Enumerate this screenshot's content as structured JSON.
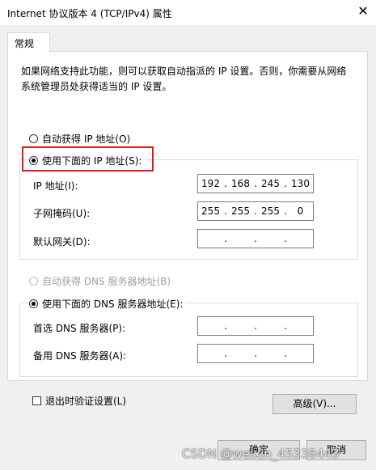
{
  "window": {
    "title": "Internet 协议版本 4 (TCP/IPv4) 属性",
    "close_glyph": "✕"
  },
  "tabs": [
    {
      "label": "常规"
    }
  ],
  "description": "如果网络支持此功能，则可以获取自动指派的 IP 设置。否则，你需要从网络系统管理员处获得适当的 IP 设置。",
  "ip": {
    "auto_label": "自动获得 IP 地址(O)",
    "manual_label": "使用下面的 IP 地址(S):",
    "selected": "manual",
    "fields": [
      {
        "label": "IP 地址(I):",
        "octets": [
          "192",
          "168",
          "245",
          "130"
        ]
      },
      {
        "label": "子网掩码(U):",
        "octets": [
          "255",
          "255",
          "255",
          "0"
        ]
      },
      {
        "label": "默认网关(D):",
        "octets": [
          "",
          "",
          "",
          ""
        ]
      }
    ]
  },
  "dns": {
    "auto_label": "自动获得 DNS 服务器地址(B)",
    "manual_label": "使用下面的 DNS 服务器地址(E):",
    "selected": "manual",
    "fields": [
      {
        "label": "首选 DNS 服务器(P):",
        "octets": [
          "",
          "",
          "",
          ""
        ]
      },
      {
        "label": "备用 DNS 服务器(A):",
        "octets": [
          "",
          "",
          "",
          ""
        ]
      }
    ]
  },
  "validate_checkbox": {
    "label": "退出时验证设置(L)",
    "checked": false
  },
  "buttons": {
    "advanced": "高级(V)...",
    "ok": "确定",
    "cancel": "取消"
  },
  "watermark": "CSDN @weixin_45338443",
  "highlight_color": "#e1191b"
}
